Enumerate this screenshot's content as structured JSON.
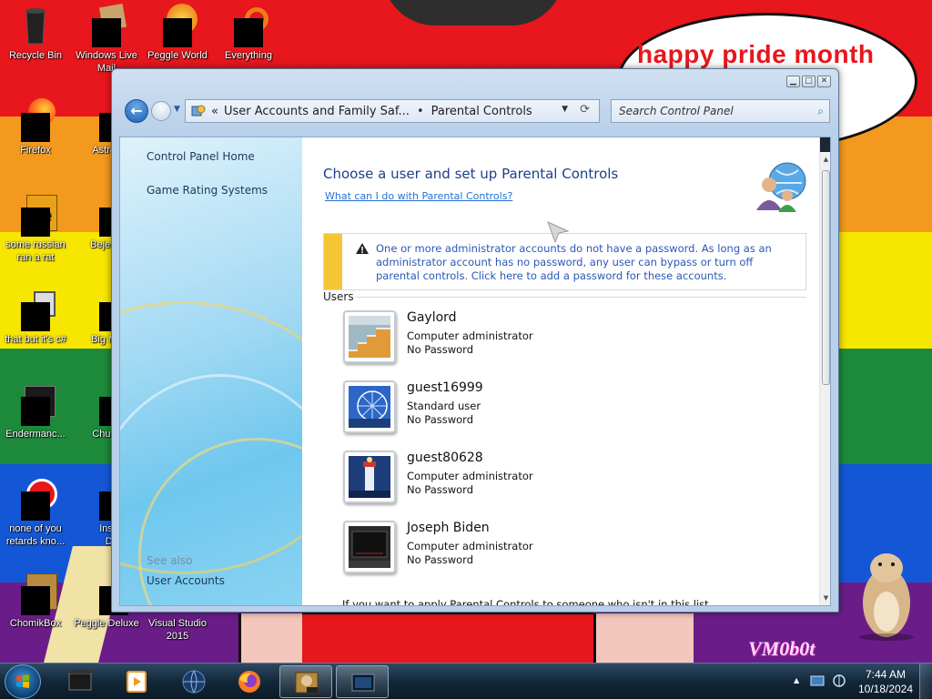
{
  "desktop": {
    "speech_text": "happy pride month",
    "watermark": "VM0b0t",
    "icons": [
      {
        "label": "Recycle Bin",
        "icon": "recycle-bin-icon"
      },
      {
        "label": "Windows Live Mail",
        "icon": "mail-icon"
      },
      {
        "label": "Peggle World",
        "icon": "peggle-icon"
      },
      {
        "label": "Everything",
        "icon": "search-app-icon"
      },
      {
        "label": "Firefox",
        "icon": "firefox-icon"
      },
      {
        "label": "Astro Delu",
        "icon": "game-icon"
      },
      {
        "label": "some russian ran a rat",
        "icon": "document-icon"
      },
      {
        "label": "Bejew Delu",
        "icon": "game-icon"
      },
      {
        "label": "that but it's c#",
        "icon": "folder-icon"
      },
      {
        "label": "Big M Delu",
        "icon": "game-icon"
      },
      {
        "label": "Endermanc...",
        "icon": "app-icon"
      },
      {
        "label": "Chuz Delu",
        "icon": "game-icon"
      },
      {
        "label": "none of you retards kno...",
        "icon": "app-icon"
      },
      {
        "label": "Insaniq Delu",
        "icon": "game-icon"
      },
      {
        "label": "ChomikBox",
        "icon": "chomikbox-icon"
      },
      {
        "label": "Peggle Deluxe",
        "icon": "peggle-icon"
      },
      {
        "label": "Visual Studio 2015",
        "icon": "visual-studio-icon"
      }
    ]
  },
  "window": {
    "address": {
      "crumb_1": "User Accounts and Family Saf...",
      "crumb_2": "Parental Controls",
      "separator": "•"
    },
    "search_placeholder": "Search Control Panel",
    "left_pane": {
      "links": [
        "Control Panel Home",
        "Game Rating Systems"
      ],
      "see_also_label": "See also",
      "see_also_links": [
        "User Accounts"
      ]
    },
    "main": {
      "title": "Choose a user and set up Parental Controls",
      "help_link": "What can I do with Parental Controls?",
      "warning_text": "One or more administrator accounts do not have a password. As long as an administrator account has no password, any user can bypass or turn off parental controls. Click here to add a password for these accounts.",
      "users_label": "Users",
      "users": [
        {
          "name": "Gaylord",
          "role": "Computer administrator",
          "password": "No Password",
          "picture": "stairs"
        },
        {
          "name": "guest16999",
          "role": "Standard user",
          "password": "No Password",
          "picture": "ferris-wheel"
        },
        {
          "name": "guest80628",
          "role": "Computer administrator",
          "password": "No Password",
          "picture": "lighthouse"
        },
        {
          "name": "Joseph Biden",
          "role": "Computer administrator",
          "password": "No Password",
          "picture": "dark-screen"
        }
      ],
      "footer_text": "If you want to apply Parental Controls to someone who isn't in this list"
    }
  },
  "taskbar": {
    "items": [
      "explorer-icon",
      "media-player-icon",
      "globe-icon",
      "firefox-icon",
      "chomikbox-icon",
      "control-panel-icon"
    ],
    "active_items": [
      4,
      5
    ],
    "clock_time": "7:44 AM",
    "clock_date": "10/18/2024"
  },
  "colors": {
    "link_blue": "#2472d6",
    "title_blue": "#1e3f8a",
    "warning_yellow": "#f6c534"
  }
}
